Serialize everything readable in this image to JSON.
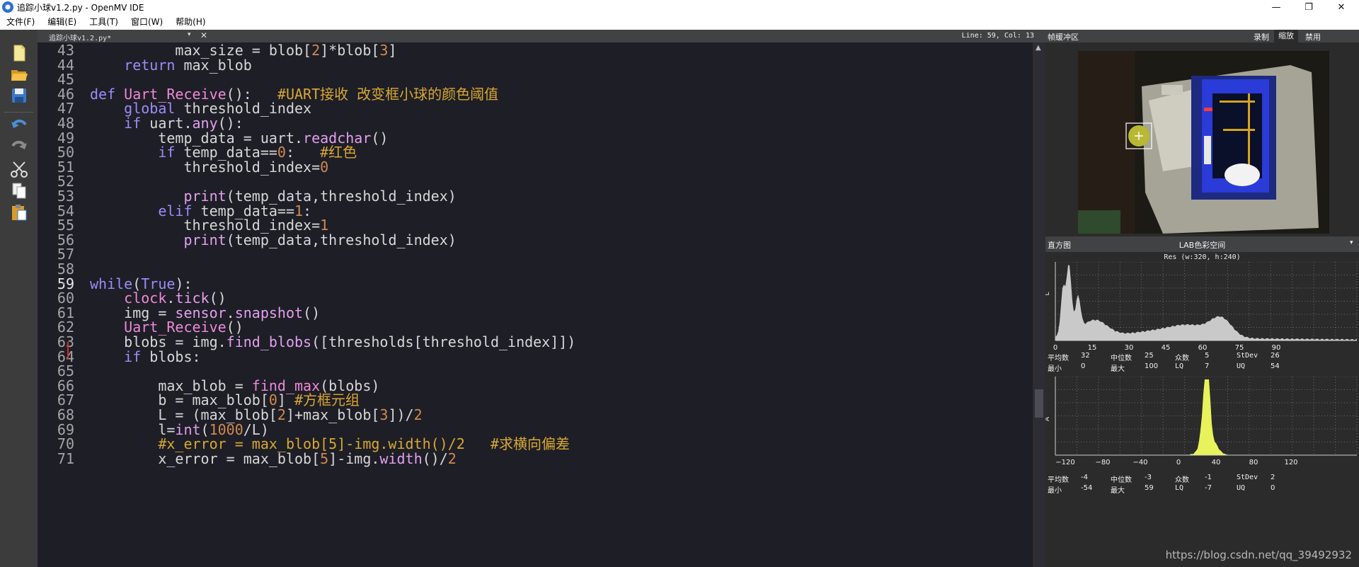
{
  "window": {
    "title": "追踪小球v1.2.py - OpenMV IDE",
    "controls": [
      "—",
      "❐",
      "✕"
    ]
  },
  "menu": [
    "文件(F)",
    "编辑(E)",
    "工具(T)",
    "窗口(W)",
    "帮助(H)"
  ],
  "toolbar": {
    "icons": [
      "new-file-icon",
      "open-folder-icon",
      "save-icon",
      "undo-icon",
      "redo-icon",
      "cut-icon",
      "copy-icon",
      "paste-icon"
    ]
  },
  "editor": {
    "filename": "追踪小球v1.2.py*",
    "dropdown": "▾",
    "close": "✕",
    "cursor": "Line: 59, Col: 13",
    "current_line": 59,
    "colors": {
      "keyword": "#9b8cf7",
      "function": "#e2a0ec",
      "number": "#d08a4d",
      "comment": "#d8a830",
      "background": "#1e1e27"
    },
    "lines": [
      {
        "n": "43",
        "fold": "",
        "tokens": [
          [
            "",
            "          max_size = blob["
          ],
          [
            "num",
            "2"
          ],
          [
            "",
            "]*blob["
          ],
          [
            "num",
            "3"
          ],
          [
            "",
            "]"
          ]
        ]
      },
      {
        "n": "44",
        "fold": "",
        "tokens": [
          [
            "",
            "    "
          ],
          [
            "kw",
            "return"
          ],
          [
            "",
            " max_blob"
          ]
        ]
      },
      {
        "n": "45",
        "fold": "",
        "tokens": []
      },
      {
        "n": "46",
        "fold": "⌄",
        "tokens": [
          [
            "kw",
            "def"
          ],
          [
            "",
            " "
          ],
          [
            "df",
            "Uart_Receive"
          ],
          [
            "",
            "():   "
          ],
          [
            "cm",
            "#UART接收 改变框小球的颜色阈值"
          ]
        ]
      },
      {
        "n": "47",
        "fold": "",
        "tokens": [
          [
            "",
            "    "
          ],
          [
            "kw",
            "global"
          ],
          [
            "",
            " threshold_index"
          ]
        ]
      },
      {
        "n": "48",
        "fold": "⌄",
        "tokens": [
          [
            "",
            "    "
          ],
          [
            "kw",
            "if"
          ],
          [
            "",
            " uart."
          ],
          [
            "fn",
            "any"
          ],
          [
            "",
            "():"
          ]
        ]
      },
      {
        "n": "49",
        "fold": "",
        "tokens": [
          [
            "",
            "        temp_data = uart."
          ],
          [
            "fn",
            "readchar"
          ],
          [
            "",
            "()"
          ]
        ]
      },
      {
        "n": "50",
        "fold": "⌄",
        "tokens": [
          [
            "",
            "        "
          ],
          [
            "kw",
            "if"
          ],
          [
            "",
            " temp_data=="
          ],
          [
            "num",
            "0"
          ],
          [
            "",
            ":   "
          ],
          [
            "cm",
            "#红色"
          ]
        ]
      },
      {
        "n": "51",
        "fold": "",
        "tokens": [
          [
            "",
            "           threshold_index="
          ],
          [
            "num",
            "0"
          ]
        ]
      },
      {
        "n": "52",
        "fold": "",
        "tokens": []
      },
      {
        "n": "53",
        "fold": "",
        "tokens": [
          [
            "",
            "           "
          ],
          [
            "fn",
            "print"
          ],
          [
            "",
            "(temp_data,threshold_index)"
          ]
        ]
      },
      {
        "n": "54",
        "fold": "⌄",
        "tokens": [
          [
            "",
            "        "
          ],
          [
            "kw",
            "elif"
          ],
          [
            "",
            " temp_data=="
          ],
          [
            "num",
            "1"
          ],
          [
            "",
            ":"
          ]
        ]
      },
      {
        "n": "55",
        "fold": "",
        "tokens": [
          [
            "",
            "           threshold_index="
          ],
          [
            "num",
            "1"
          ]
        ]
      },
      {
        "n": "56",
        "fold": "",
        "tokens": [
          [
            "",
            "           "
          ],
          [
            "fn",
            "print"
          ],
          [
            "",
            "(temp_data,threshold_index)"
          ]
        ]
      },
      {
        "n": "57",
        "fold": "",
        "tokens": []
      },
      {
        "n": "58",
        "fold": "",
        "tokens": []
      },
      {
        "n": "59",
        "fold": "⌄",
        "tokens": [
          [
            "kw",
            "while"
          ],
          [
            "",
            "("
          ],
          [
            "kw",
            "True"
          ],
          [
            "",
            "):"
          ]
        ]
      },
      {
        "n": "60",
        "fold": "",
        "tokens": [
          [
            "",
            "    "
          ],
          [
            "df",
            "clock"
          ],
          [
            "",
            "."
          ],
          [
            "fn",
            "tick"
          ],
          [
            "",
            "()"
          ]
        ]
      },
      {
        "n": "61",
        "fold": "",
        "tokens": [
          [
            "",
            "    img = "
          ],
          [
            "fn",
            "sensor"
          ],
          [
            "",
            "."
          ],
          [
            "fn",
            "snapshot"
          ],
          [
            "",
            "()"
          ]
        ]
      },
      {
        "n": "62",
        "fold": "",
        "tokens": [
          [
            "",
            "    "
          ],
          [
            "df",
            "Uart_Receive"
          ],
          [
            "",
            "()"
          ]
        ]
      },
      {
        "n": "63",
        "fold": "",
        "tokens": [
          [
            "",
            "    blobs = img."
          ],
          [
            "fn",
            "find_blobs"
          ],
          [
            "",
            "([thresholds[threshold_index]])"
          ]
        ]
      },
      {
        "n": "64",
        "fold": "",
        "tokens": [
          [
            "",
            "    "
          ],
          [
            "kw",
            "if"
          ],
          [
            "",
            " blobs:"
          ]
        ]
      },
      {
        "n": "65",
        "fold": "⌄",
        "tokens": []
      },
      {
        "n": "66",
        "fold": "",
        "tokens": [
          [
            "",
            "        max_blob = "
          ],
          [
            "df",
            "find_max"
          ],
          [
            "",
            "(blobs)"
          ]
        ]
      },
      {
        "n": "67",
        "fold": "",
        "tokens": [
          [
            "",
            "        b = max_blob["
          ],
          [
            "num",
            "0"
          ],
          [
            "",
            "] "
          ],
          [
            "cm",
            "#方框元组"
          ]
        ]
      },
      {
        "n": "68",
        "fold": "",
        "tokens": [
          [
            "",
            "        L = (max_blob["
          ],
          [
            "num",
            "2"
          ],
          [
            "",
            "]+max_blob["
          ],
          [
            "num",
            "3"
          ],
          [
            "",
            "])/"
          ],
          [
            "num",
            "2"
          ]
        ]
      },
      {
        "n": "69",
        "fold": "",
        "tokens": [
          [
            "",
            "        l="
          ],
          [
            "fn",
            "int"
          ],
          [
            "",
            "("
          ],
          [
            "num",
            "1000"
          ],
          [
            "",
            "/L)"
          ]
        ]
      },
      {
        "n": "70",
        "fold": "",
        "tokens": [
          [
            "",
            "        "
          ],
          [
            "cm",
            "#x_error = max_blob[5]-img.width()/2   #求横向偏差"
          ]
        ]
      },
      {
        "n": "71",
        "fold": "",
        "tokens": [
          [
            "",
            "        x_error = max_blob["
          ],
          [
            "num",
            "5"
          ],
          [
            "",
            "]-img."
          ],
          [
            "fn",
            "width"
          ],
          [
            "",
            "()/"
          ],
          [
            "num",
            "2"
          ]
        ]
      }
    ]
  },
  "framebuffer": {
    "title": "帧缓冲区",
    "buttons": [
      "录制",
      "缩放",
      "禁用"
    ]
  },
  "histogram": {
    "title": "直方图",
    "colorspace": "LAB色彩空间",
    "resolution": "Res (w:320, h:240)",
    "L": {
      "axis_label": "L",
      "ticks": [
        "0",
        "15",
        "30",
        "45",
        "60",
        "75",
        "90"
      ],
      "stats": [
        [
          "平均数",
          "32",
          "中位数",
          "25",
          "众数",
          "5",
          "StDev",
          "26"
        ],
        [
          "最小",
          "0",
          "最大",
          "100",
          "LQ",
          "7",
          "UQ",
          "54"
        ]
      ]
    },
    "A": {
      "axis_label": "A",
      "ticks": [
        "−120",
        "−80",
        "−40",
        "0",
        "40",
        "80",
        "120"
      ],
      "stats": [
        [
          "平均数",
          "-4",
          "中位数",
          "-3",
          "众数",
          "-1",
          "StDev",
          "2"
        ],
        [
          "最小",
          "-54",
          "最大",
          "59",
          "LQ",
          "-7",
          "UQ",
          "0"
        ]
      ]
    }
  },
  "watermark": "https://blog.csdn.net/qq_39492932"
}
